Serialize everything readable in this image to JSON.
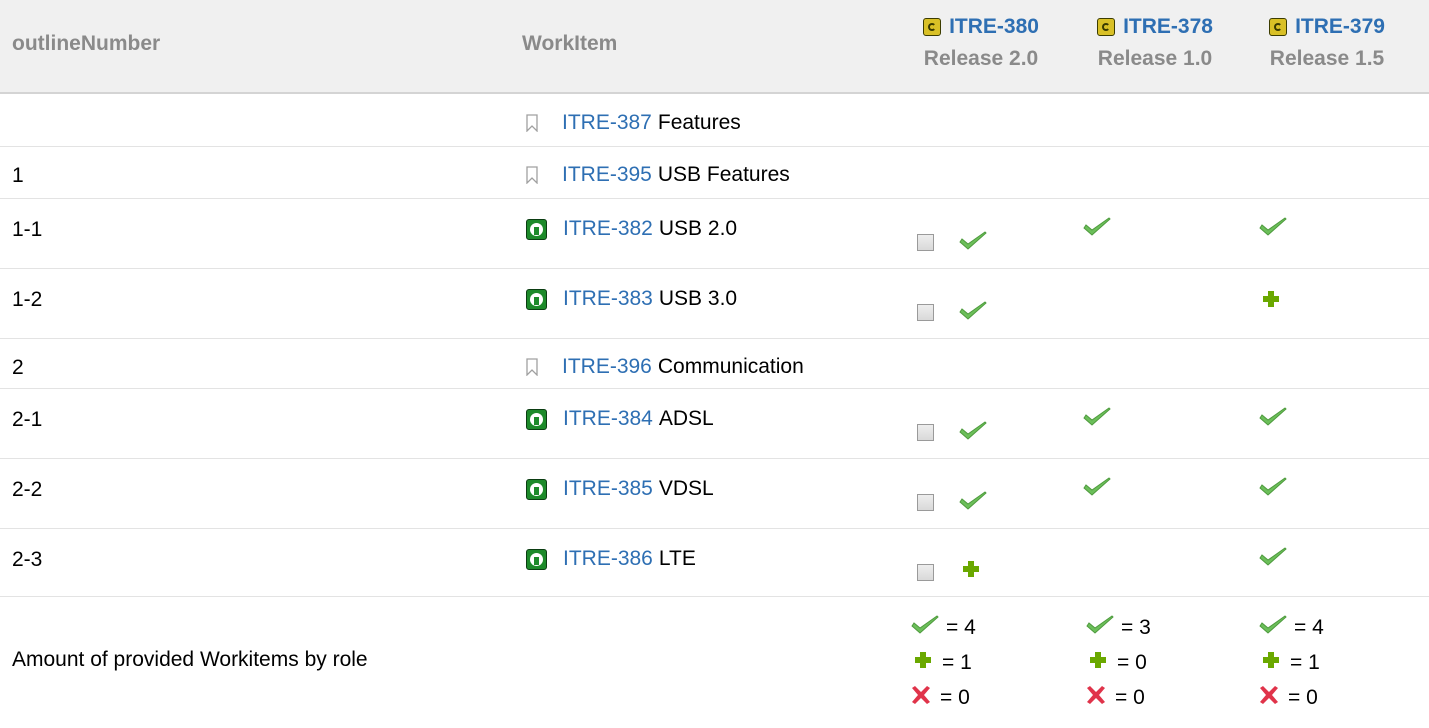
{
  "header": {
    "col_outline": "outlineNumber",
    "col_workitem": "WorkItem",
    "releases": [
      {
        "id": "ITRE-380",
        "name": "Release 2.0"
      },
      {
        "id": "ITRE-378",
        "name": "Release 1.0"
      },
      {
        "id": "ITRE-379",
        "name": "Release 1.5"
      }
    ]
  },
  "rows": [
    {
      "outline": "",
      "id": "ITRE-387",
      "title": "Features",
      "icon": "bookmark-icon",
      "marks": [
        "",
        "",
        ""
      ],
      "checkbox": false
    },
    {
      "outline": "1",
      "id": "ITRE-395",
      "title": "USB Features",
      "icon": "bookmark-icon",
      "marks": [
        "",
        "",
        ""
      ],
      "checkbox": false
    },
    {
      "outline": "1-1",
      "id": "ITRE-382",
      "title": "USB 2.0",
      "icon": "requirement-icon",
      "marks": [
        "check",
        "check",
        "check"
      ],
      "checkbox": true
    },
    {
      "outline": "1-2",
      "id": "ITRE-383",
      "title": "USB 3.0",
      "icon": "requirement-icon",
      "marks": [
        "check",
        "",
        "plus"
      ],
      "checkbox": true
    },
    {
      "outline": "2",
      "id": "ITRE-396",
      "title": "Communication",
      "icon": "bookmark-icon",
      "marks": [
        "",
        "",
        ""
      ],
      "checkbox": false
    },
    {
      "outline": "2-1",
      "id": "ITRE-384",
      "title": "ADSL",
      "icon": "requirement-icon",
      "marks": [
        "check",
        "check",
        "check"
      ],
      "checkbox": true
    },
    {
      "outline": "2-2",
      "id": "ITRE-385",
      "title": "VDSL",
      "icon": "requirement-icon",
      "marks": [
        "check",
        "check",
        "check"
      ],
      "checkbox": true
    },
    {
      "outline": "2-3",
      "id": "ITRE-386",
      "title": "LTE",
      "icon": "requirement-icon",
      "marks": [
        "plus",
        "",
        "check"
      ],
      "checkbox": true
    }
  ],
  "summary": {
    "label": "Amount of provided Workitems by role",
    "counts": [
      {
        "check": "= 4",
        "plus": "= 1",
        "cross": "= 0"
      },
      {
        "check": "= 3",
        "plus": "= 0",
        "cross": "= 0"
      },
      {
        "check": "= 4",
        "plus": "= 1",
        "cross": "= 0"
      }
    ]
  },
  "colors": {
    "header_bg": "#f0f0f0",
    "link": "#2e6fb3",
    "check": "#5cb85c",
    "plus": "#6aa800",
    "cross": "#e0334a"
  }
}
